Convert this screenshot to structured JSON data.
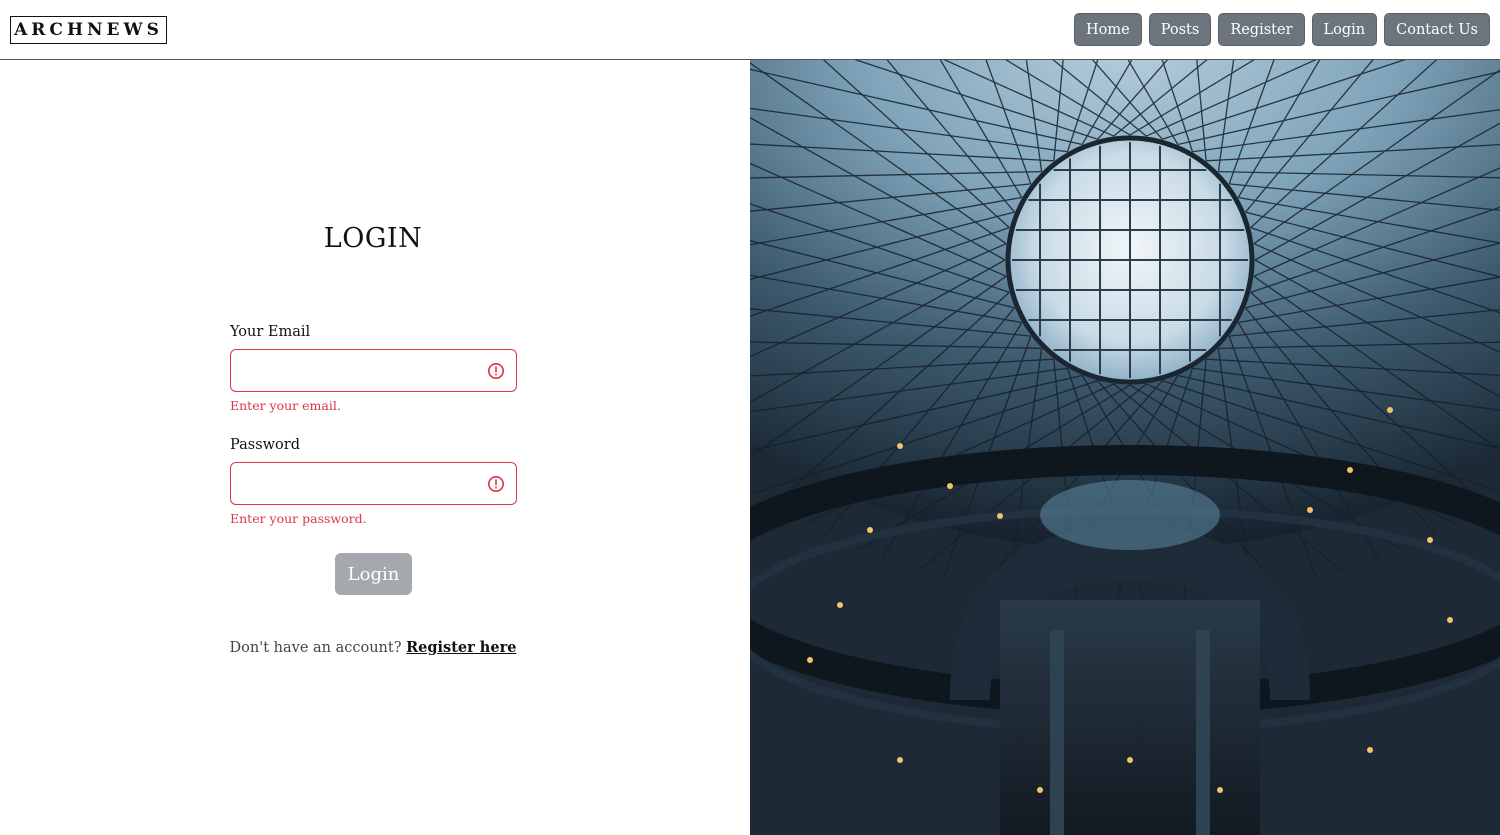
{
  "header": {
    "logo": "ARCHNEWS",
    "nav": [
      {
        "label": "Home"
      },
      {
        "label": "Posts"
      },
      {
        "label": "Register"
      },
      {
        "label": "Login"
      },
      {
        "label": "Contact Us"
      }
    ]
  },
  "login": {
    "title": "LOGIN",
    "email": {
      "label": "Your Email",
      "value": "",
      "placeholder": "",
      "error": "Enter your email."
    },
    "password": {
      "label": "Password",
      "value": "",
      "placeholder": "",
      "error": "Enter your password."
    },
    "submit_label": "Login",
    "footer_text": "Don't have an account?",
    "register_link": "Register here"
  },
  "hero_image": {
    "icon": "architecture-dome-photo"
  },
  "colors": {
    "error": "#dc3545",
    "nav_button": "#6c757d",
    "submit_disabled": "#a5a9ae"
  }
}
